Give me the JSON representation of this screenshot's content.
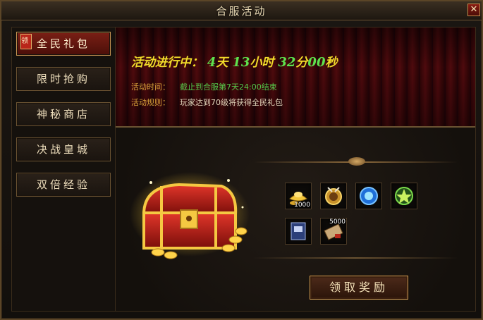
{
  "window": {
    "title": "合服活动",
    "close_label": "✕"
  },
  "sidebar": {
    "badge": "领",
    "tabs": [
      {
        "label": "全民礼包",
        "active": true
      },
      {
        "label": "限时抢购",
        "active": false
      },
      {
        "label": "神秘商店",
        "active": false
      },
      {
        "label": "决战皇城",
        "active": false
      },
      {
        "label": "双倍经验",
        "active": false
      }
    ]
  },
  "banner": {
    "countdown_label": "活动进行中：",
    "days": "4",
    "days_unit": "天",
    "hours": "13",
    "hours_unit": "小时",
    "minutes": "32",
    "minutes_unit": "分",
    "seconds": "00",
    "seconds_unit": "秒",
    "time_label": "活动时间：",
    "time_value": "截止到合服第7天24:00结束",
    "rule_label": "活动规则：",
    "rule_value": "玩家达到70级将获得全民礼包"
  },
  "rewards": [
    {
      "icon": "gold-ingot-icon",
      "count": "1000"
    },
    {
      "icon": "gold-medal-icon",
      "count": ""
    },
    {
      "icon": "blue-orb-icon",
      "count": ""
    },
    {
      "icon": "green-star-emblem-icon",
      "count": ""
    },
    {
      "icon": "blue-book-icon",
      "count": ""
    },
    {
      "icon": "scroll-icon",
      "count": "5000"
    }
  ],
  "claim_button": {
    "label": "领取奖励"
  },
  "colors": {
    "accent_gold": "#f2dc2a",
    "countdown_green": "#5ee34e",
    "rule_green": "#55c94a",
    "active_tab_red": "#7a1f15"
  }
}
